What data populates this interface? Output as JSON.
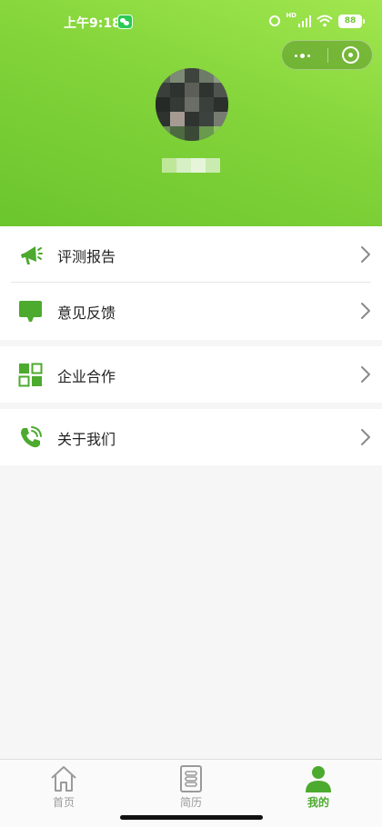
{
  "status_bar": {
    "time": "上午9:18",
    "network_badge": "HD",
    "battery": "88"
  },
  "capsule": {
    "more_icon": "more-dots-icon",
    "close_icon": "target-close-icon"
  },
  "profile": {
    "avatar": "pixelated-avatar",
    "username": ""
  },
  "menu": {
    "groups": [
      {
        "items": [
          {
            "label": "评测报告",
            "icon": "megaphone-icon"
          },
          {
            "label": "意见反馈",
            "icon": "monitor-icon"
          }
        ]
      },
      {
        "items": [
          {
            "label": "企业合作",
            "icon": "grid-squares-icon"
          }
        ]
      },
      {
        "items": [
          {
            "label": "关于我们",
            "icon": "phone-call-icon"
          }
        ]
      }
    ]
  },
  "tabbar": {
    "tabs": [
      {
        "label": "首页",
        "icon": "home-icon",
        "active": false
      },
      {
        "label": "简历",
        "icon": "resume-icon",
        "active": false
      },
      {
        "label": "我的",
        "icon": "person-icon",
        "active": true
      }
    ]
  },
  "colors": {
    "accent": "#4caa2e",
    "header_start": "#a1e64f",
    "header_end": "#6bc52d",
    "inactive_tab": "#9a9a9a"
  }
}
